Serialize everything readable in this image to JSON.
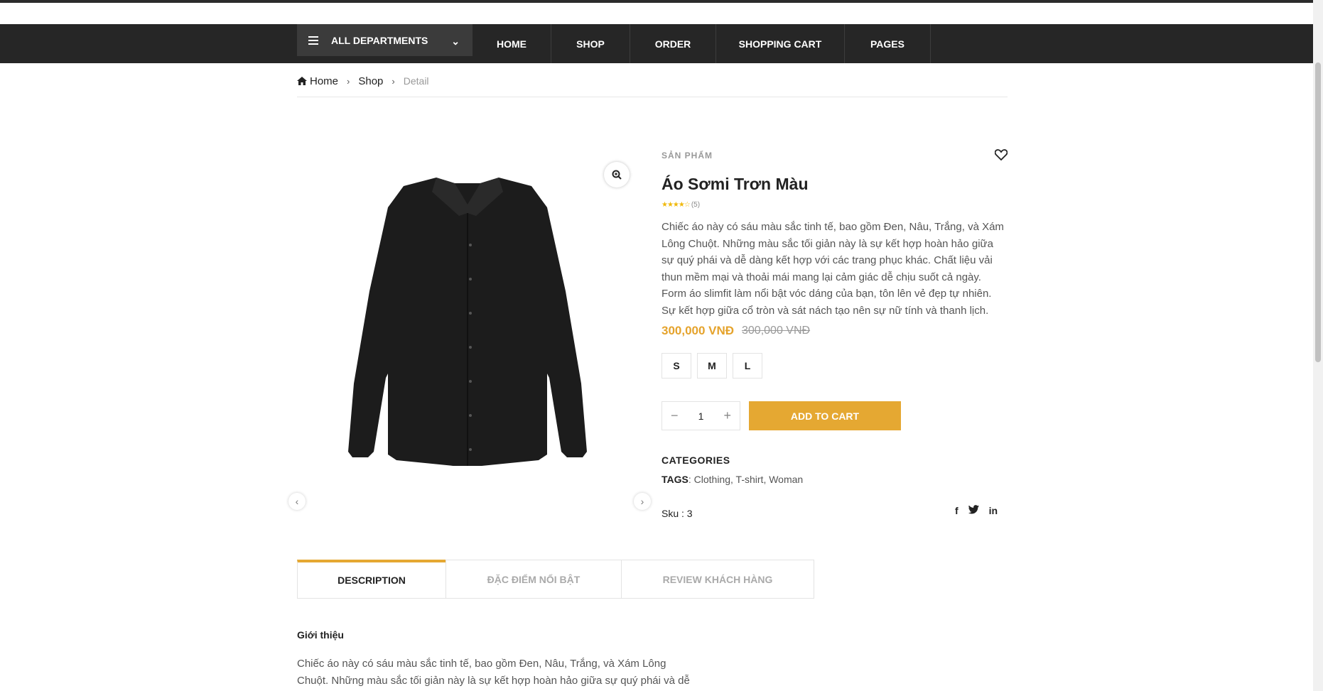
{
  "nav": {
    "departments_label": "ALL DEPARTMENTS",
    "links": [
      "HOME",
      "SHOP",
      "ORDER",
      "SHOPPING CART",
      "PAGES"
    ]
  },
  "breadcrumb": {
    "home": "Home",
    "shop": "Shop",
    "current": "Detail"
  },
  "product": {
    "category_label": "SẢN PHẨM",
    "title": "Áo Sơmi Trơn Màu",
    "stars": "★★★★☆",
    "rating_count": "(5)",
    "rating": 4,
    "description": "Chiếc áo này có sáu màu sắc tinh tế, bao gồm Đen, Nâu, Trắng, và Xám Lông Chuột. Những màu sắc tối giản này là sự kết hợp hoàn hảo giữa sự quý phái và dễ dàng kết hợp với các trang phục khác. Chất liệu vải thun mềm mại và thoải mái mang lại cảm giác dễ chịu suốt cả ngày. Form áo slimfit làm nổi bật vóc dáng của bạn, tôn lên vẻ đẹp tự nhiên. Sự kết hợp giữa cổ tròn và sát nách tạo nên sự nữ tính và thanh lịch.",
    "price": "300,000 VNĐ",
    "old_price": "300,000 VNĐ",
    "sizes": [
      "S",
      "M",
      "L"
    ],
    "quantity": "1",
    "add_to_cart": "ADD TO CART",
    "categories_label": "CATEGORIES",
    "tags_label": "TAGS",
    "tags": [
      "Clothing",
      "T-shirt",
      "Woman"
    ],
    "sku_text": "Sku : 3",
    "social": [
      "f",
      "t",
      "in"
    ]
  },
  "tabs": [
    "DESCRIPTION",
    "ĐẶC ĐIỂM NỔI BẬT",
    "REVIEW KHÁCH HÀNG"
  ],
  "content": {
    "heading": "Giới thiệu",
    "paragraph": "Chiếc áo này có sáu màu sắc tinh tế, bao gồm Đen, Nâu, Trắng, và Xám Lông Chuột. Những màu sắc tối giản này là sự kết hợp hoàn hảo giữa sự quý phái và dễ dàng kết"
  },
  "colors": {
    "accent": "#e5a832",
    "navbar": "#262626",
    "price": "#e5a32c"
  },
  "icons": [
    "menu-icon",
    "chevron-down-icon",
    "home-icon",
    "zoom-icon",
    "heart-icon",
    "arrow-left-icon",
    "arrow-right-icon",
    "facebook-icon",
    "twitter-icon",
    "linkedin-icon"
  ]
}
